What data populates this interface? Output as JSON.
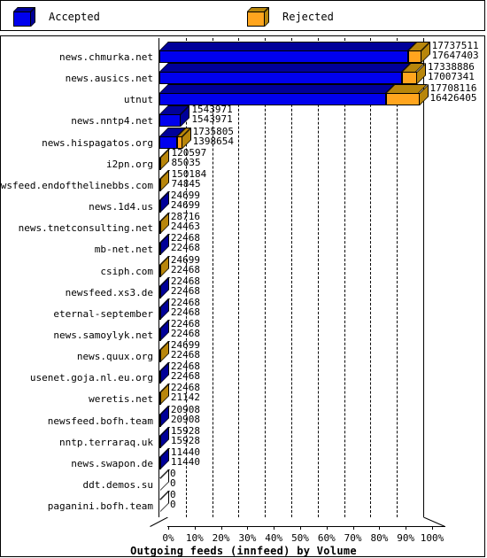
{
  "legend": {
    "items": [
      {
        "label": "Accepted",
        "color": "#0000EE",
        "dark": "#000099",
        "icon": "cube-icon"
      },
      {
        "label": "Rejected",
        "color": "#FFA51E",
        "dark": "#B8860B",
        "icon": "cube-icon"
      }
    ]
  },
  "chart_data": {
    "type": "bar",
    "orientation": "horizontal",
    "stacked": true,
    "title": "Outgoing feeds (innfeed) by Volume",
    "xlabel": "",
    "ylabel": "",
    "xlim": [
      0,
      100
    ],
    "xticks": [
      "0%",
      "10%",
      "20%",
      "30%",
      "40%",
      "50%",
      "60%",
      "70%",
      "80%",
      "90%",
      "100%"
    ],
    "grid": true,
    "legend_position": "top",
    "series": [
      {
        "name": "Accepted",
        "color": "#0000EE"
      },
      {
        "name": "Rejected",
        "color": "#FFA51E"
      }
    ],
    "categories": [
      "news.chmurka.net",
      "news.ausics.net",
      "utnut",
      "news.nntp4.net",
      "news.hispagatos.org",
      "i2pn.org",
      "newsfeed.endofthelinebbs.com",
      "news.1d4.us",
      "news.tnetconsulting.net",
      "mb-net.net",
      "csiph.com",
      "newsfeed.xs3.de",
      "eternal-september",
      "news.samoylyk.net",
      "news.quux.org",
      "usenet.goja.nl.eu.org",
      "weretis.net",
      "newsfeed.bofh.team",
      "nntp.terraraq.uk",
      "news.swapon.de",
      "ddt.demos.su",
      "paganini.bofh.team"
    ],
    "accepted": [
      17737511,
      17338886,
      17708116,
      1543971,
      1735805,
      120597,
      150184,
      24699,
      28716,
      22468,
      24699,
      22468,
      22468,
      22468,
      24699,
      22468,
      22468,
      20908,
      15928,
      11440,
      0,
      0
    ],
    "rejected": [
      17647403,
      17007341,
      16426405,
      1543971,
      1398654,
      85035,
      74845,
      24699,
      24463,
      22468,
      22468,
      22468,
      22468,
      22468,
      22468,
      22468,
      21142,
      20908,
      15928,
      11440,
      0,
      0
    ],
    "rows": [
      {
        "label": "news.chmurka.net",
        "accepted": "17737511",
        "rejected": "17647403",
        "acc_pct": 94.2,
        "rej_pct": 5.0
      },
      {
        "label": "news.ausics.net",
        "accepted": "17338886",
        "rejected": "17007341",
        "acc_pct": 92.1,
        "rej_pct": 5.5
      },
      {
        "label": "utnut",
        "accepted": "17708116",
        "rejected": "16426405",
        "acc_pct": 86.0,
        "rej_pct": 12.5
      },
      {
        "label": "news.nntp4.net",
        "accepted": "1543971",
        "rejected": "1543971",
        "acc_pct": 8.2,
        "rej_pct": 0.0
      },
      {
        "label": "news.hispagatos.org",
        "accepted": "1735805",
        "rejected": "1398654",
        "acc_pct": 6.6,
        "rej_pct": 2.0
      },
      {
        "label": "i2pn.org",
        "accepted": "120597",
        "rejected": "85035",
        "acc_pct": 0.0,
        "rej_pct": 0.5
      },
      {
        "label": "newsfeed.endofthelinebbs.com",
        "accepted": "150184",
        "rejected": "74845",
        "acc_pct": 0.0,
        "rej_pct": 0.5
      },
      {
        "label": "news.1d4.us",
        "accepted": "24699",
        "rejected": "24699",
        "acc_pct": 0.3,
        "rej_pct": 0.0
      },
      {
        "label": "news.tnetconsulting.net",
        "accepted": "28716",
        "rejected": "24463",
        "acc_pct": 0.0,
        "rej_pct": 0.3
      },
      {
        "label": "mb-net.net",
        "accepted": "22468",
        "rejected": "22468",
        "acc_pct": 0.3,
        "rej_pct": 0.0
      },
      {
        "label": "csiph.com",
        "accepted": "24699",
        "rejected": "22468",
        "acc_pct": 0.0,
        "rej_pct": 0.3
      },
      {
        "label": "newsfeed.xs3.de",
        "accepted": "22468",
        "rejected": "22468",
        "acc_pct": 0.3,
        "rej_pct": 0.0
      },
      {
        "label": "eternal-september",
        "accepted": "22468",
        "rejected": "22468",
        "acc_pct": 0.3,
        "rej_pct": 0.0
      },
      {
        "label": "news.samoylyk.net",
        "accepted": "22468",
        "rejected": "22468",
        "acc_pct": 0.3,
        "rej_pct": 0.0
      },
      {
        "label": "news.quux.org",
        "accepted": "24699",
        "rejected": "22468",
        "acc_pct": 0.0,
        "rej_pct": 0.3
      },
      {
        "label": "usenet.goja.nl.eu.org",
        "accepted": "22468",
        "rejected": "22468",
        "acc_pct": 0.3,
        "rej_pct": 0.0
      },
      {
        "label": "weretis.net",
        "accepted": "22468",
        "rejected": "21142",
        "acc_pct": 0.0,
        "rej_pct": 0.3
      },
      {
        "label": "newsfeed.bofh.team",
        "accepted": "20908",
        "rejected": "20908",
        "acc_pct": 0.3,
        "rej_pct": 0.0
      },
      {
        "label": "nntp.terraraq.uk",
        "accepted": "15928",
        "rejected": "15928",
        "acc_pct": 0.3,
        "rej_pct": 0.0
      },
      {
        "label": "news.swapon.de",
        "accepted": "11440",
        "rejected": "11440",
        "acc_pct": 0.3,
        "rej_pct": 0.0
      },
      {
        "label": "ddt.demos.su",
        "accepted": "0",
        "rejected": "0",
        "acc_pct": 0.0,
        "rej_pct": 0.0
      },
      {
        "label": "paganini.bofh.team",
        "accepted": "0",
        "rejected": "0",
        "acc_pct": 0.0,
        "rej_pct": 0.0
      }
    ]
  }
}
